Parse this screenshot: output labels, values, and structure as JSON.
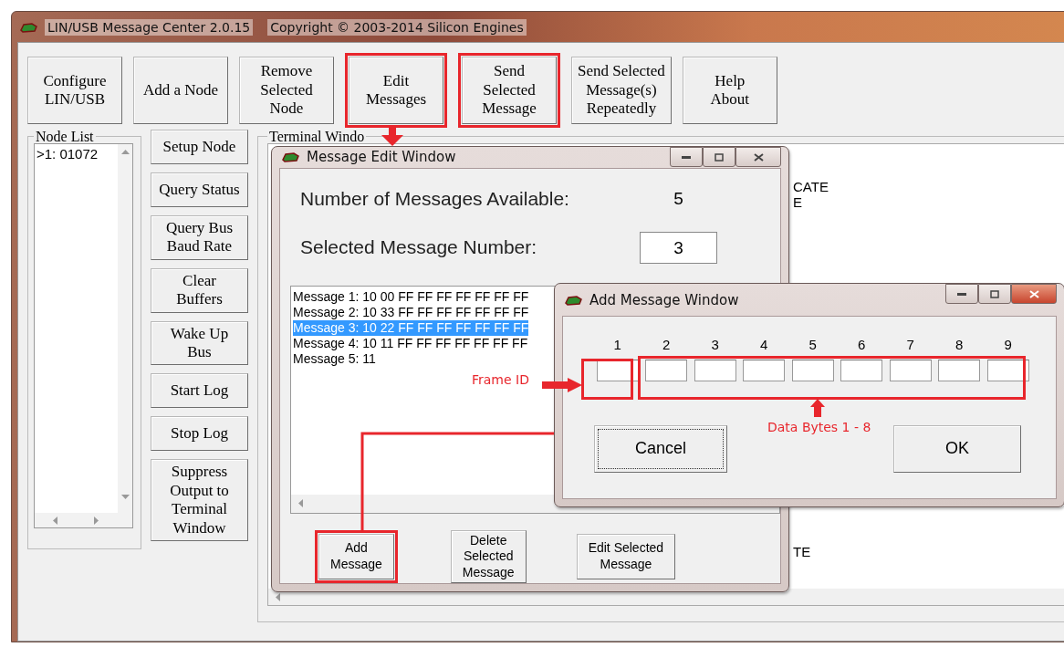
{
  "window": {
    "title": "LIN/USB Message Center 2.0.15",
    "copyright": "Copyright © 2003-2014 Silicon Engines"
  },
  "toolbar": [
    {
      "label": "Configure\nLIN/USB",
      "highlighted": false
    },
    {
      "label": "Add a Node",
      "highlighted": false
    },
    {
      "label": "Remove\nSelected\nNode",
      "highlighted": false
    },
    {
      "label": "Edit\nMessages",
      "highlighted": true
    },
    {
      "label": "Send\nSelected\nMessage",
      "highlighted": true
    },
    {
      "label": "Send Selected\nMessage(s)\nRepeatedly",
      "highlighted": false
    },
    {
      "label": "Help\nAbout",
      "highlighted": false
    }
  ],
  "node_list": {
    "title": "Node List",
    "items": [
      {
        "label": ">1: 01072",
        "selected": false
      }
    ]
  },
  "side_buttons": [
    "Setup Node",
    "Query Status",
    "Query Bus\nBaud Rate",
    "Clear\nBuffers",
    "Wake Up\nBus",
    "Start Log",
    "Stop Log",
    "Suppress\nOutput to\nTerminal\nWindow"
  ],
  "terminal": {
    "title": "Terminal Windo",
    "blocks": [
      [
        "CATE",
        "E"
      ],
      [
        "TE"
      ]
    ]
  },
  "message_edit_window": {
    "title": "Message Edit Window",
    "fields": [
      {
        "label": "Number of Messages Available:",
        "value": "5",
        "kind": "readout"
      },
      {
        "label": "Selected Message Number:",
        "value": "3",
        "kind": "input"
      }
    ],
    "messages": [
      {
        "text": "Message 1: 10 00 FF FF FF FF FF FF FF",
        "selected": false
      },
      {
        "text": "Message 2: 10 33 FF FF FF FF FF FF FF",
        "selected": false
      },
      {
        "text": "Message 3: 10 22 FF FF FF FF FF FF FF",
        "selected": true
      },
      {
        "text": "Message 4: 10 11 FF FF FF FF FF FF FF",
        "selected": false
      },
      {
        "text": "Message 5: 11",
        "selected": false
      }
    ],
    "buttons": [
      {
        "label": "Add\nMessage",
        "highlighted": true
      },
      {
        "label": "Delete\nSelected\nMessage",
        "highlighted": false
      },
      {
        "label": "Edit Selected\nMessage",
        "highlighted": false
      }
    ]
  },
  "add_message_window": {
    "title": "Add Message Window",
    "columns": [
      "1",
      "2",
      "3",
      "4",
      "5",
      "6",
      "7",
      "8",
      "9"
    ],
    "buttons": [
      {
        "label": "Cancel",
        "focused": true
      },
      {
        "label": "OK",
        "focused": false
      }
    ]
  },
  "annotations": {
    "frame_id": "Frame ID",
    "data_bytes": "Data Bytes 1 - 8"
  }
}
